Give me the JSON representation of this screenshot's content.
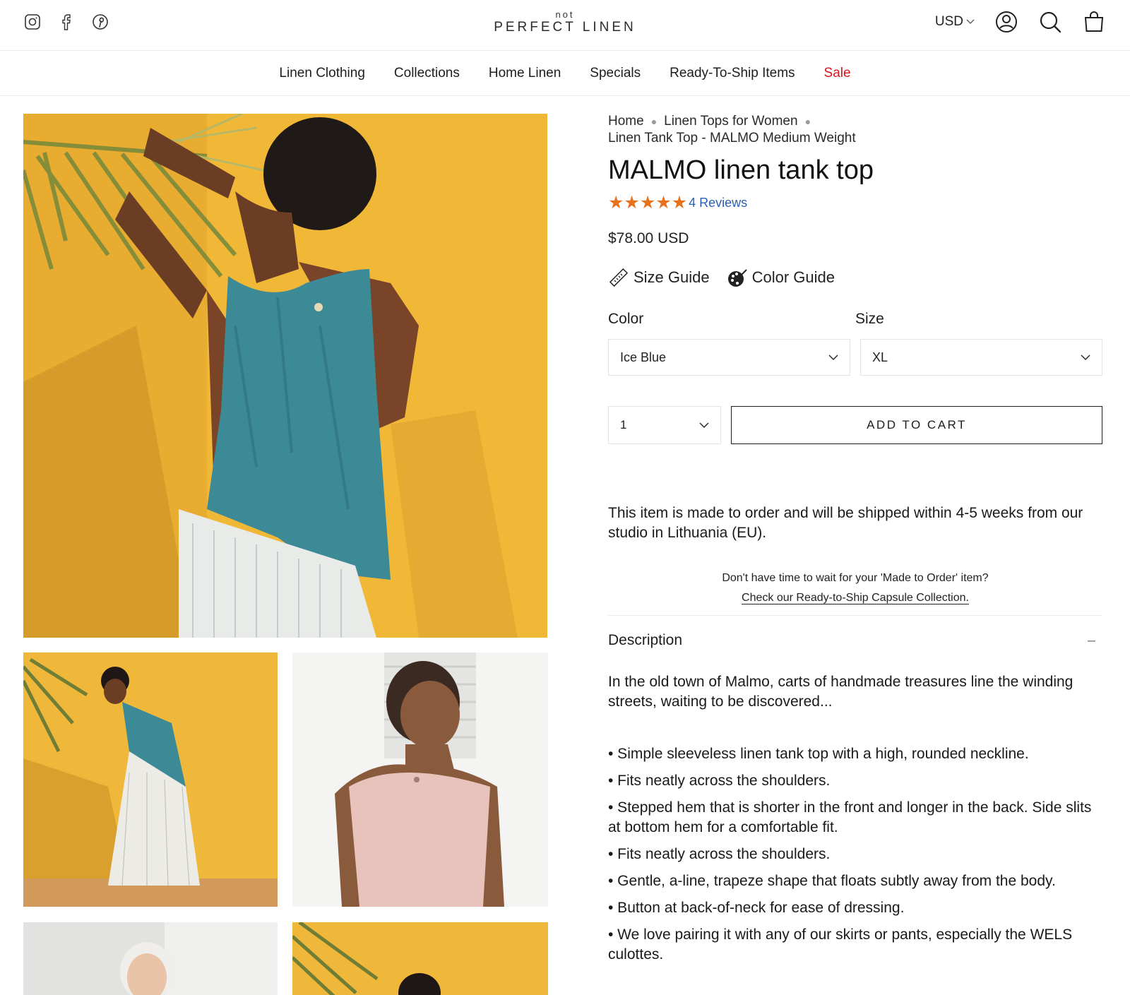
{
  "header": {
    "logo_small": "not",
    "logo_big": "PERFECT LINEN",
    "currency": "USD",
    "social_icons": [
      "instagram-icon",
      "facebook-icon",
      "pinterest-icon"
    ],
    "tool_icons": [
      "account-icon",
      "search-icon",
      "cart-bag-icon"
    ]
  },
  "nav": {
    "items": [
      {
        "label": "Linen Clothing"
      },
      {
        "label": "Collections"
      },
      {
        "label": "Home Linen"
      },
      {
        "label": "Specials"
      },
      {
        "label": "Ready-To-Ship Items"
      },
      {
        "label": "Sale"
      }
    ],
    "sale_color": "#d8141c"
  },
  "breadcrumb": {
    "home": "Home",
    "category": "Linen Tops for Women",
    "current": "Linen Tank Top - MALMO Medium Weight"
  },
  "product": {
    "title": "MALMO linen tank top",
    "rating": 5,
    "reviews_label": "4 Reviews",
    "price": "$78.00 USD",
    "size_guide": "Size Guide",
    "color_guide": "Color Guide",
    "color_label": "Color",
    "color_value": "Ice Blue",
    "size_label": "Size",
    "size_value": "XL",
    "quantity": "1",
    "add_to_cart": "ADD TO CART",
    "star_color": "#e8711b"
  },
  "shipping": {
    "made_to_order": "This item is made to order and will be shipped within 4-5 weeks from our studio in Lithuania (EU).",
    "wait_question": "Don't have time to wait for your 'Made to Order' item?",
    "wait_link": "Check our Ready-to-Ship Capsule Collection."
  },
  "description": {
    "heading": "Description",
    "toggle": "–",
    "intro": "In the old town of Malmo, carts of handmade treasures line the winding streets, waiting to be discovered...",
    "bullets": [
      "• Simple sleeveless linen tank top with a high, rounded neckline.",
      "• Fits neatly across the shoulders.",
      "• Stepped hem that is shorter in the front and longer in the back. Side slits at bottom hem for a comfortable fit.",
      "• Fits neatly across the shoulders.",
      "• Gentle, a-line, trapeze shape that floats subtly away from the body.",
      "• Button at back-of-neck for ease of dressing.",
      "• We love pairing it with any of our skirts or pants, especially the WELS culottes."
    ]
  }
}
